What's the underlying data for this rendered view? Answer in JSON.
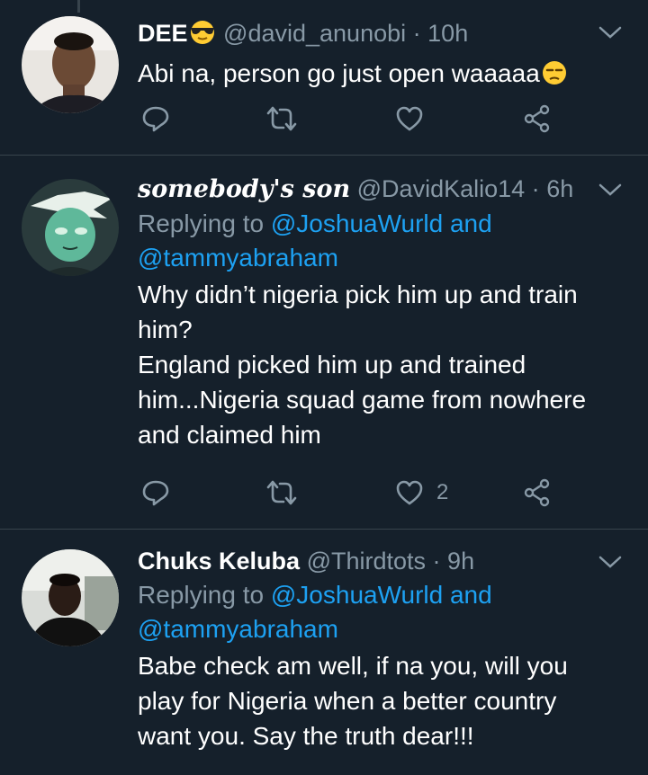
{
  "tweets": [
    {
      "name": "DEE",
      "handle": "@david_anunobi",
      "sep": "·",
      "time": "10h",
      "body": "Abi na, person go just open waaaaa",
      "reply_count": "",
      "retweet_count": "",
      "like_count": ""
    },
    {
      "name": "somebody's son",
      "handle": "@DavidKalio14",
      "sep": "·",
      "time": "6h",
      "reply_prefix": "Replying to",
      "mention1": "@JoshuaWurld",
      "and": "and",
      "mention2": "@tammyabraham",
      "body_lines": [
        "Why didn’t nigeria pick him up and train",
        "him?",
        "England picked him up and trained",
        "him...Nigeria squad game from nowhere",
        "and claimed him"
      ],
      "like_count": "2"
    },
    {
      "name": "Chuks Keluba",
      "handle": "@Thirdtots",
      "sep": "·",
      "time": "9h",
      "reply_prefix": "Replying to",
      "mention1": "@JoshuaWurld",
      "and": "and",
      "mention2": "@tammyabraham",
      "body_lines": [
        "Babe check am well, if na you, will you",
        "play for Nigeria when a better country",
        "want you. Say the truth dear!!!"
      ]
    }
  ],
  "colors": {
    "background": "#15202b",
    "secondary_text": "#8899a6",
    "link": "#1da1f2",
    "divider": "#38444d"
  },
  "icons": [
    "reply-icon",
    "retweet-icon",
    "like-icon",
    "share-icon",
    "chevron-down-icon",
    "sunglasses-emoji",
    "unamused-emoji"
  ]
}
